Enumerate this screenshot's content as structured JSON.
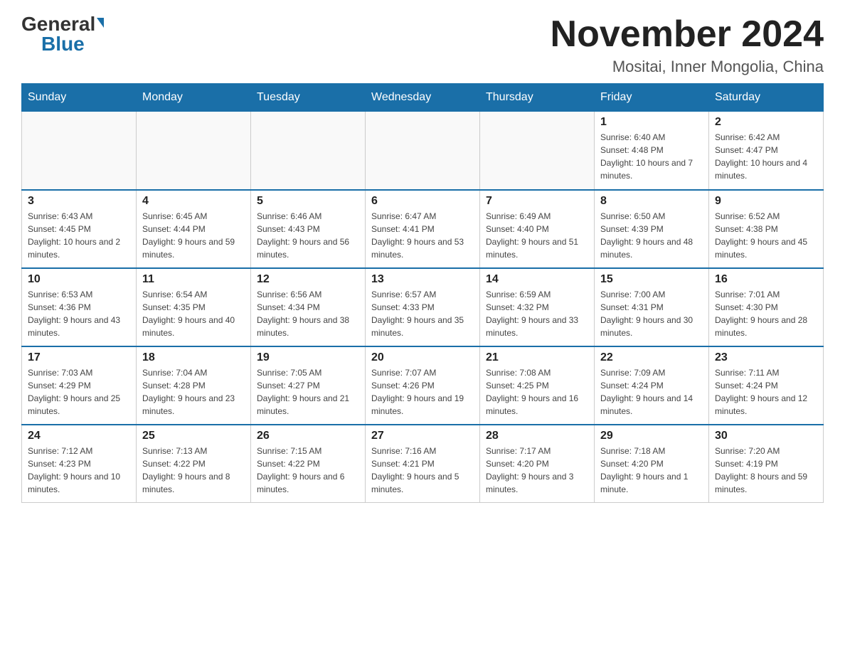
{
  "logo": {
    "general": "General",
    "blue": "Blue"
  },
  "title": {
    "month": "November 2024",
    "location": "Mositai, Inner Mongolia, China"
  },
  "days_of_week": [
    "Sunday",
    "Monday",
    "Tuesday",
    "Wednesday",
    "Thursday",
    "Friday",
    "Saturday"
  ],
  "weeks": [
    [
      {
        "day": "",
        "info": ""
      },
      {
        "day": "",
        "info": ""
      },
      {
        "day": "",
        "info": ""
      },
      {
        "day": "",
        "info": ""
      },
      {
        "day": "",
        "info": ""
      },
      {
        "day": "1",
        "info": "Sunrise: 6:40 AM\nSunset: 4:48 PM\nDaylight: 10 hours and 7 minutes."
      },
      {
        "day": "2",
        "info": "Sunrise: 6:42 AM\nSunset: 4:47 PM\nDaylight: 10 hours and 4 minutes."
      }
    ],
    [
      {
        "day": "3",
        "info": "Sunrise: 6:43 AM\nSunset: 4:45 PM\nDaylight: 10 hours and 2 minutes."
      },
      {
        "day": "4",
        "info": "Sunrise: 6:45 AM\nSunset: 4:44 PM\nDaylight: 9 hours and 59 minutes."
      },
      {
        "day": "5",
        "info": "Sunrise: 6:46 AM\nSunset: 4:43 PM\nDaylight: 9 hours and 56 minutes."
      },
      {
        "day": "6",
        "info": "Sunrise: 6:47 AM\nSunset: 4:41 PM\nDaylight: 9 hours and 53 minutes."
      },
      {
        "day": "7",
        "info": "Sunrise: 6:49 AM\nSunset: 4:40 PM\nDaylight: 9 hours and 51 minutes."
      },
      {
        "day": "8",
        "info": "Sunrise: 6:50 AM\nSunset: 4:39 PM\nDaylight: 9 hours and 48 minutes."
      },
      {
        "day": "9",
        "info": "Sunrise: 6:52 AM\nSunset: 4:38 PM\nDaylight: 9 hours and 45 minutes."
      }
    ],
    [
      {
        "day": "10",
        "info": "Sunrise: 6:53 AM\nSunset: 4:36 PM\nDaylight: 9 hours and 43 minutes."
      },
      {
        "day": "11",
        "info": "Sunrise: 6:54 AM\nSunset: 4:35 PM\nDaylight: 9 hours and 40 minutes."
      },
      {
        "day": "12",
        "info": "Sunrise: 6:56 AM\nSunset: 4:34 PM\nDaylight: 9 hours and 38 minutes."
      },
      {
        "day": "13",
        "info": "Sunrise: 6:57 AM\nSunset: 4:33 PM\nDaylight: 9 hours and 35 minutes."
      },
      {
        "day": "14",
        "info": "Sunrise: 6:59 AM\nSunset: 4:32 PM\nDaylight: 9 hours and 33 minutes."
      },
      {
        "day": "15",
        "info": "Sunrise: 7:00 AM\nSunset: 4:31 PM\nDaylight: 9 hours and 30 minutes."
      },
      {
        "day": "16",
        "info": "Sunrise: 7:01 AM\nSunset: 4:30 PM\nDaylight: 9 hours and 28 minutes."
      }
    ],
    [
      {
        "day": "17",
        "info": "Sunrise: 7:03 AM\nSunset: 4:29 PM\nDaylight: 9 hours and 25 minutes."
      },
      {
        "day": "18",
        "info": "Sunrise: 7:04 AM\nSunset: 4:28 PM\nDaylight: 9 hours and 23 minutes."
      },
      {
        "day": "19",
        "info": "Sunrise: 7:05 AM\nSunset: 4:27 PM\nDaylight: 9 hours and 21 minutes."
      },
      {
        "day": "20",
        "info": "Sunrise: 7:07 AM\nSunset: 4:26 PM\nDaylight: 9 hours and 19 minutes."
      },
      {
        "day": "21",
        "info": "Sunrise: 7:08 AM\nSunset: 4:25 PM\nDaylight: 9 hours and 16 minutes."
      },
      {
        "day": "22",
        "info": "Sunrise: 7:09 AM\nSunset: 4:24 PM\nDaylight: 9 hours and 14 minutes."
      },
      {
        "day": "23",
        "info": "Sunrise: 7:11 AM\nSunset: 4:24 PM\nDaylight: 9 hours and 12 minutes."
      }
    ],
    [
      {
        "day": "24",
        "info": "Sunrise: 7:12 AM\nSunset: 4:23 PM\nDaylight: 9 hours and 10 minutes."
      },
      {
        "day": "25",
        "info": "Sunrise: 7:13 AM\nSunset: 4:22 PM\nDaylight: 9 hours and 8 minutes."
      },
      {
        "day": "26",
        "info": "Sunrise: 7:15 AM\nSunset: 4:22 PM\nDaylight: 9 hours and 6 minutes."
      },
      {
        "day": "27",
        "info": "Sunrise: 7:16 AM\nSunset: 4:21 PM\nDaylight: 9 hours and 5 minutes."
      },
      {
        "day": "28",
        "info": "Sunrise: 7:17 AM\nSunset: 4:20 PM\nDaylight: 9 hours and 3 minutes."
      },
      {
        "day": "29",
        "info": "Sunrise: 7:18 AM\nSunset: 4:20 PM\nDaylight: 9 hours and 1 minute."
      },
      {
        "day": "30",
        "info": "Sunrise: 7:20 AM\nSunset: 4:19 PM\nDaylight: 8 hours and 59 minutes."
      }
    ]
  ]
}
